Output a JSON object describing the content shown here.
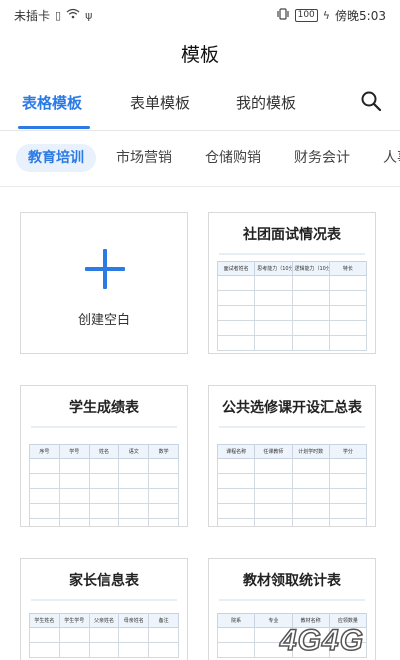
{
  "status": {
    "carrier": "未插卡",
    "battery": "100",
    "time": "傍晚5:03"
  },
  "page_title": "模板",
  "main_tabs": [
    {
      "label": "表格模板",
      "active": true
    },
    {
      "label": "表单模板",
      "active": false
    },
    {
      "label": "我的模板",
      "active": false
    }
  ],
  "categories": [
    {
      "label": "教育培训",
      "active": true
    },
    {
      "label": "市场营销",
      "active": false
    },
    {
      "label": "仓储购销",
      "active": false
    },
    {
      "label": "财务会计",
      "active": false
    },
    {
      "label": "人事",
      "active": false
    }
  ],
  "create_blank_label": "创建空白",
  "templates": [
    {
      "title": "社团面试情况表",
      "columns": [
        "面试者姓名",
        "思考能力（10分）",
        "逻辑能力（10分）",
        "特长"
      ]
    },
    {
      "title": "学生成绩表",
      "columns": [
        "序号",
        "学号",
        "姓名",
        "语文",
        "数学"
      ]
    },
    {
      "title": "公共选修课开设汇总表",
      "columns": [
        "课程名称",
        "任课教师",
        "计划学时数",
        "学分"
      ]
    },
    {
      "title": "家长信息表",
      "columns": [
        "学生姓名",
        "学生学号",
        "父亲姓名",
        "母亲姓名",
        "备注"
      ]
    },
    {
      "title": "教材领取统计表",
      "columns": [
        "院系",
        "专业",
        "教材名称",
        "应领数量"
      ]
    }
  ],
  "watermark": "4G4G"
}
